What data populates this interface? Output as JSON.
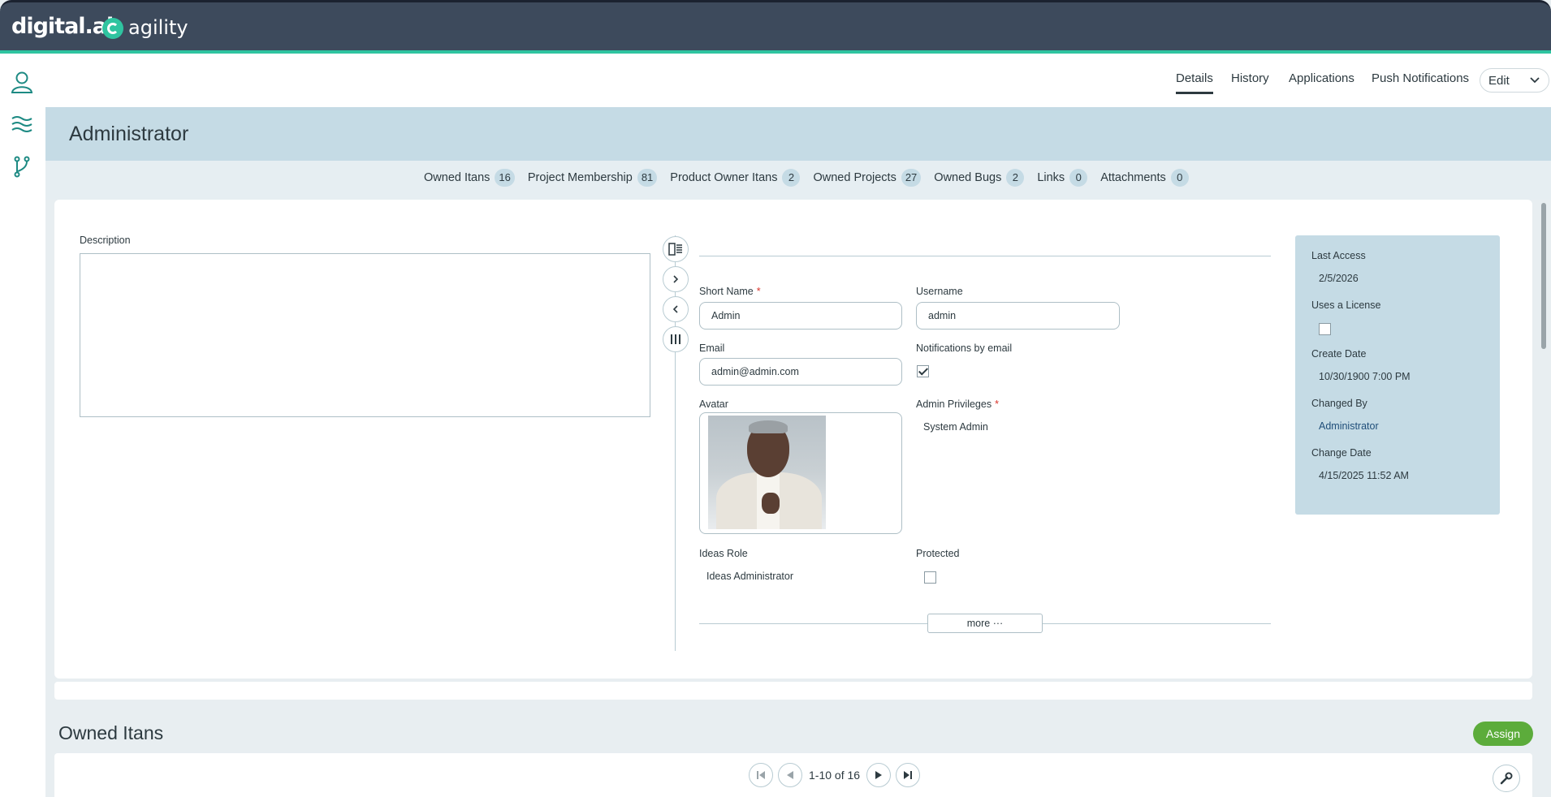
{
  "header": {
    "brand": "digital.ai",
    "product": "agility"
  },
  "tabs": [
    {
      "label": "Details",
      "active": true
    },
    {
      "label": "History"
    },
    {
      "label": "Applications"
    },
    {
      "label": "Push Notifications"
    }
  ],
  "edit_label": "Edit",
  "title": "Administrator",
  "relations": [
    {
      "label": "Owned Itans",
      "count": "16"
    },
    {
      "label": "Project Membership",
      "count": "81"
    },
    {
      "label": "Product Owner Itans",
      "count": "2"
    },
    {
      "label": "Owned Projects",
      "count": "27"
    },
    {
      "label": "Owned Bugs",
      "count": "2"
    },
    {
      "label": "Links",
      "count": "0"
    },
    {
      "label": "Attachments",
      "count": "0"
    }
  ],
  "form": {
    "description_label": "Description",
    "short_name_label": "Short Name",
    "short_name_value": "Admin",
    "username_label": "Username",
    "username_value": "admin",
    "email_label": "Email",
    "email_value": "admin@admin.com",
    "notifications_label": "Notifications by email",
    "notifications_checked": true,
    "avatar_label": "Avatar",
    "admin_privileges_label": "Admin Privileges",
    "admin_privileges_value": "System Admin",
    "ideas_role_label": "Ideas Role",
    "ideas_role_value": "Ideas Administrator",
    "protected_label": "Protected",
    "protected_checked": false,
    "more_label": "more ···"
  },
  "side_panel": {
    "last_access_label": "Last Access",
    "last_access_value": "2/5/2026",
    "uses_license_label": "Uses a License",
    "uses_license_checked": false,
    "create_date_label": "Create Date",
    "create_date_value": "10/30/1900 7:00 PM",
    "changed_by_label": "Changed By",
    "changed_by_value": "Administrator",
    "change_date_label": "Change Date",
    "change_date_value": "4/15/2025 11:52 AM"
  },
  "owned_itans": {
    "title": "Owned Itans",
    "assign_label": "Assign",
    "pager_text": "1-10 of 16"
  },
  "colors": {
    "header_bg": "#3d4a5c",
    "accent": "#2fc4a0",
    "panel_bg": "#c5dbe5",
    "assign_green": "#5cac3b"
  }
}
